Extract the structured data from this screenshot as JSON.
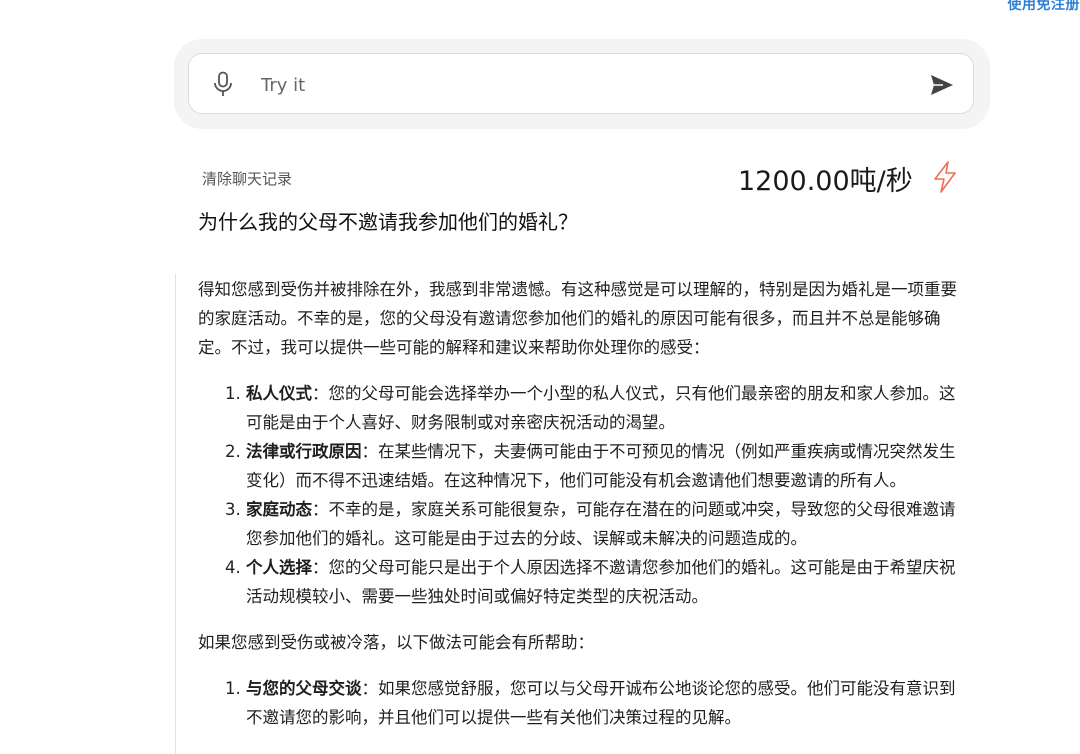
{
  "header": {
    "corner_text": "使用免注册"
  },
  "prompt": {
    "placeholder": "Try it",
    "mic_icon": "microphone-icon",
    "send_icon": "send-arrow-icon"
  },
  "toolbar": {
    "clear_history": "清除聊天记录",
    "speed": "1200.00吨/秒",
    "speed_icon": "lightning-bolt-icon",
    "accent_color": "#f26b50"
  },
  "question": "为什么我的父母不邀请我参加他们的婚礼？",
  "answer": {
    "intro": "得知您感到受伤并被排除在外，我感到非常遗憾。有这种感觉是可以理解的，特别是因为婚礼是一项重要的家庭活动。不幸的是，您的父母没有邀请您参加他们的婚礼的原因可能有很多，而且并不总是能够确定。不过，我可以提供一些可能的解释和建议来帮助你处理你的感受：",
    "reasons": [
      {
        "title": "私人仪式",
        "text": "：您的父母可能会选择举办一个小型的私人仪式，只有他们最亲密的朋友和家人参加。这可能是由于个人喜好、财务限制或对亲密庆祝活动的渴望。"
      },
      {
        "title": "法律或行政原因",
        "text": "：在某些情况下，夫妻俩可能由于不可预见的情况（例如严重疾病或情况突然发生变化）而不得不迅速结婚。在这种情况下，他们可能没有机会邀请他们想要邀请的所有人。"
      },
      {
        "title": "家庭动态",
        "text": "：不幸的是，家庭关系可能很复杂，可能存在潜在的问题或冲突，导致您的父母很难邀请您参加他们的婚礼。这可能是由于过去的分歧、误解或未解决的问题造成的。"
      },
      {
        "title": "个人选择",
        "text": "：您的父母可能只是出于个人原因选择不邀请您参加他们的婚礼。这可能是由于希望庆祝活动规模较小、需要一些独处时间或偏好特定类型的庆祝活动。"
      }
    ],
    "help_intro": "如果您感到受伤或被冷落，以下做法可能会有所帮助：",
    "tips": [
      {
        "title": "与您的父母交谈",
        "text": "：如果您感觉舒服，您可以与父母开诚布公地谈论您的感受。他们可能没有意识到不邀请您的影响，并且他们可以提供一些有关他们决策过程的见解。"
      }
    ]
  }
}
